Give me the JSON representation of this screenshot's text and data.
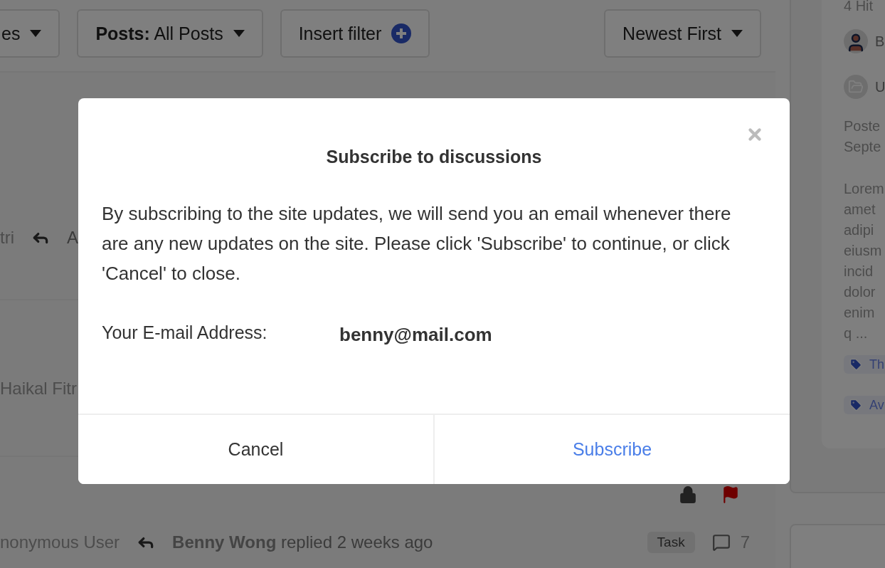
{
  "filters": [
    {
      "label": "es",
      "kind": "dropdown"
    },
    {
      "label": "**Posts:** All Posts",
      "kind": "dropdown"
    },
    {
      "label": "Insert filter",
      "kind": "add"
    }
  ],
  "sort": {
    "label": "Newest First"
  },
  "posts": [
    {
      "author": "tri",
      "last_reply": "A"
    },
    {
      "author": "Haikal Fitr"
    },
    {
      "locked": true,
      "flagged": true,
      "author": "nonymous User",
      "last_reply": "**Benny Wong** replied 2 weeks ago",
      "type": "Task",
      "comments": "7"
    }
  ],
  "sidebar": {
    "hits": "4 Hit",
    "author": "B",
    "category": "U",
    "posted": [
      "Poste",
      "Septe"
    ],
    "excerpt": [
      "Lorem",
      "amet",
      "adipi",
      "eiusm",
      "incid",
      "dolor",
      "enim",
      "q ..."
    ],
    "tags": [
      "Th",
      "Av"
    ]
  },
  "modal": {
    "title": "Subscribe to discussions",
    "body": "By subscribing to the site updates, we will send you an email whenever there are any new updates on the site. Please click 'Subscribe' to continue, or click 'Cancel' to close.",
    "email_label": "Your E-mail Address:",
    "email": "benny@mail.com",
    "buttons": [
      {
        "label": "Cancel",
        "kind": "cancel"
      },
      {
        "label": "Subscribe",
        "kind": "primary"
      }
    ]
  }
}
